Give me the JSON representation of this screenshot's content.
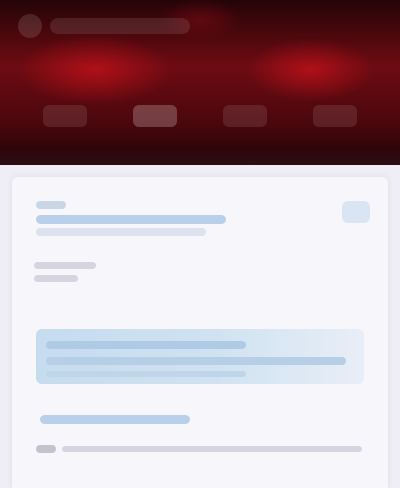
{
  "colors": {
    "hero_dark": "#240407",
    "hero_red": "#6e0b12",
    "page_background": "#efeef6",
    "card_background": "#f7f6fb",
    "accent_blue": "#c5dcef"
  },
  "hero": {
    "logo_icon": "logo-icon",
    "nav_items": [
      {
        "label": ""
      },
      {
        "label": ""
      },
      {
        "label": ""
      },
      {
        "label": ""
      }
    ]
  },
  "card": {
    "header_link": "",
    "header_subtext": "",
    "action_icon": "badge-icon",
    "section_label": "",
    "highlight_text": "",
    "link_text": "",
    "footer_text": ""
  }
}
